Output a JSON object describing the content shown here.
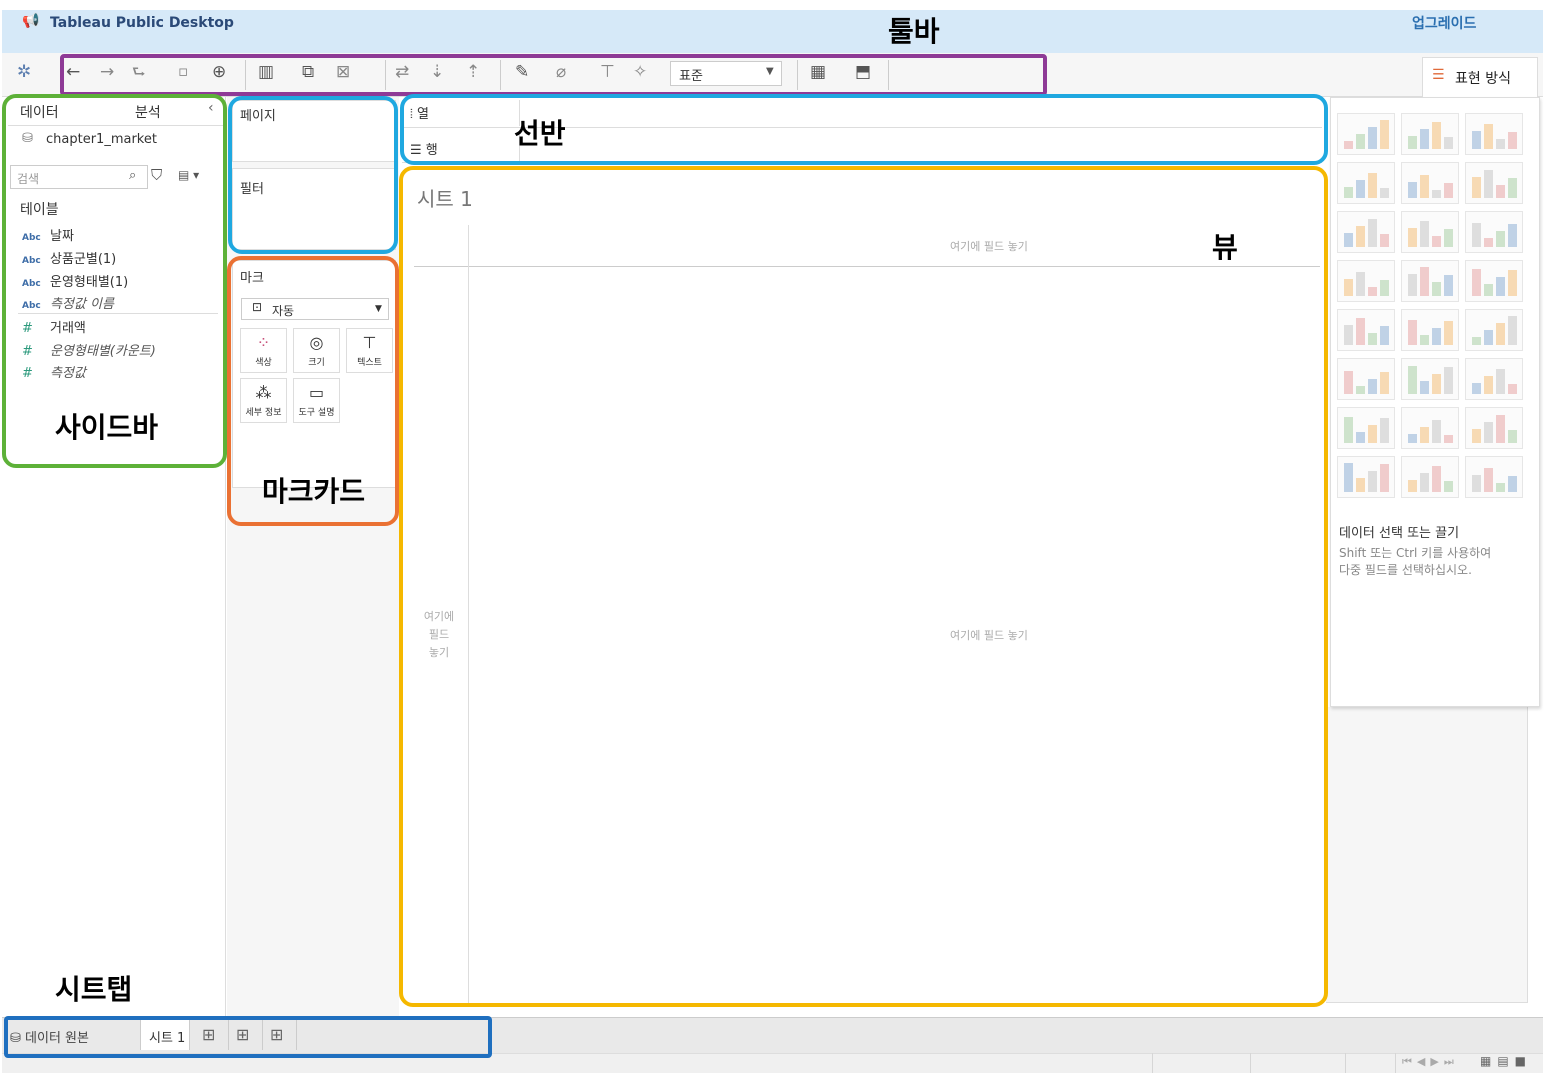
{
  "app": {
    "title": "Tableau Public Desktop",
    "upgrade_label": "업그레이드"
  },
  "toolbar": {
    "fit_selected": "표준",
    "showme_label": "표현 방식"
  },
  "sidebar": {
    "tab_data": "데이터",
    "tab_analysis": "분석",
    "datasource": "chapter1_market",
    "search_placeholder": "검색",
    "tables_title": "테이블",
    "dimensions": [
      {
        "type": "Abc",
        "name": "날짜"
      },
      {
        "type": "Abc",
        "name": "상품군별(1)"
      },
      {
        "type": "Abc",
        "name": "운영형태별(1)"
      },
      {
        "type": "Abc",
        "name": "측정값 이름"
      }
    ],
    "measures": [
      {
        "type": "#",
        "name": "거래액"
      },
      {
        "type": "#",
        "name": "운영형태별(카운트)"
      },
      {
        "type": "#",
        "name": "측정값"
      }
    ]
  },
  "cards": {
    "pages": "페이지",
    "filters": "필터",
    "marks": "마크",
    "marks_type": "자동",
    "mark_buttons": [
      "색상",
      "크기",
      "텍스트",
      "세부 정보",
      "도구 설명"
    ]
  },
  "shelves": {
    "columns": "열",
    "rows": "행"
  },
  "view": {
    "sheet_title": "시트 1",
    "column_drop": "여기에 필드 놓기",
    "row_drop": [
      "여기에",
      "필드",
      "놓기"
    ],
    "body_drop": "여기에 필드 놓기"
  },
  "showme": {
    "hint_title": "데이터 선택 또는 끌기",
    "hint_line1": "Shift 또는 Ctrl 키를 사용하여",
    "hint_line2": "다중 필드를 선택하십시오."
  },
  "bottom": {
    "datasource_tab": "데이터 원본",
    "sheet_tab": "시트 1"
  },
  "annotations": {
    "toolbar": "툴바",
    "shelves": "선반",
    "view": "뷰",
    "sidebar": "사이드바",
    "marks_card": "마크카드",
    "sheet_tabs": "시트탭",
    "colors": {
      "toolbar": "#8e3a96",
      "shelves": "#1fa8e0",
      "view": "#f5b800",
      "sidebar": "#5db138",
      "marks": "#ea7133",
      "tabs": "#1f6fbf"
    }
  }
}
